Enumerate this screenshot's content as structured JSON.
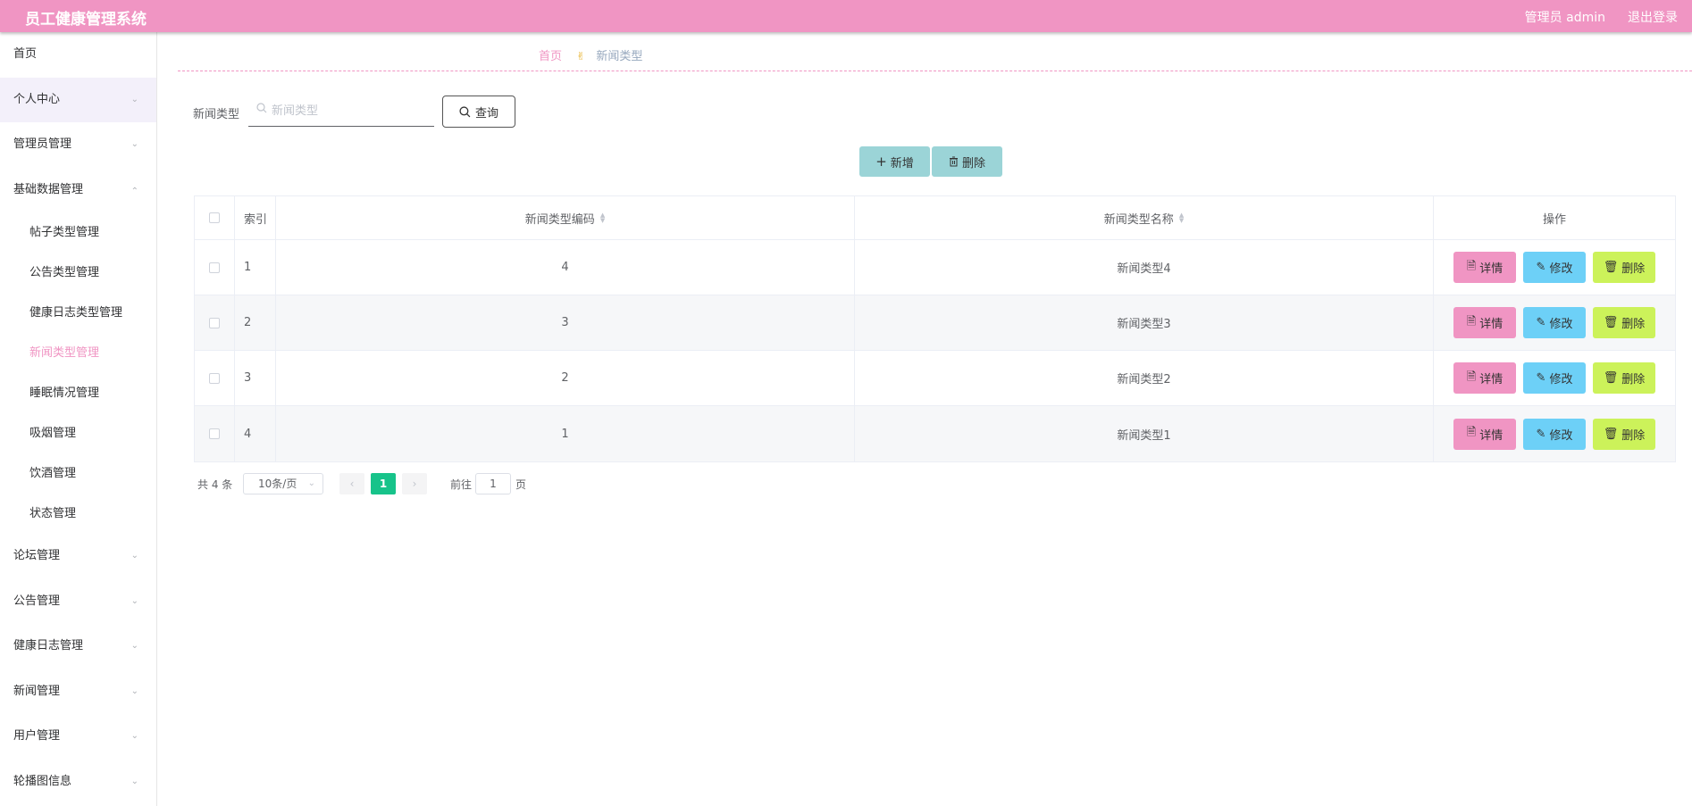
{
  "header": {
    "app_title": "员工健康管理系统",
    "admin_label": "管理员 admin",
    "logout": "退出登录",
    "bg_color": "#f095c3"
  },
  "sidebar": {
    "items": [
      {
        "label": "首页"
      },
      {
        "label": "个人中心"
      },
      {
        "label": "管理员管理"
      },
      {
        "label": "基础数据管理"
      },
      {
        "label": "论坛管理"
      },
      {
        "label": "公告管理"
      },
      {
        "label": "健康日志管理"
      },
      {
        "label": "新闻管理"
      },
      {
        "label": "用户管理"
      },
      {
        "label": "轮播图信息"
      }
    ],
    "sub_items": [
      {
        "label": "帖子类型管理"
      },
      {
        "label": "公告类型管理"
      },
      {
        "label": "健康日志类型管理"
      },
      {
        "label": "新闻类型管理"
      },
      {
        "label": "睡眠情况管理"
      },
      {
        "label": "吸烟管理"
      },
      {
        "label": "饮酒管理"
      },
      {
        "label": "状态管理"
      }
    ]
  },
  "breadcrumb": {
    "home": "首页",
    "current": "新闻类型"
  },
  "search": {
    "label": "新闻类型",
    "placeholder": "新闻类型",
    "value": "",
    "button": "查询"
  },
  "actions": {
    "add": "新增",
    "delete": "删除"
  },
  "table": {
    "columns": {
      "index": "索引",
      "code": "新闻类型编码",
      "name": "新闻类型名称",
      "ops": "操作"
    },
    "rows": [
      {
        "index": "1",
        "code": "4",
        "name": "新闻类型4"
      },
      {
        "index": "2",
        "code": "3",
        "name": "新闻类型3"
      },
      {
        "index": "3",
        "code": "2",
        "name": "新闻类型2"
      },
      {
        "index": "4",
        "code": "1",
        "name": "新闻类型1"
      }
    ],
    "op_labels": {
      "detail": "详情",
      "edit": "修改",
      "delete": "删除"
    }
  },
  "pagination": {
    "total": "共 4 条",
    "page_size": "10条/页",
    "current_page": "1",
    "goto_label": "前往",
    "goto_value": "1",
    "goto_suffix": "页"
  },
  "colors": {
    "accent": "#f095c3",
    "detail": "#f095c3",
    "edit": "#6dd0f7",
    "delete": "#ccf25a",
    "toolbar": "#9bd4d7",
    "page_active": "#17c38a"
  }
}
